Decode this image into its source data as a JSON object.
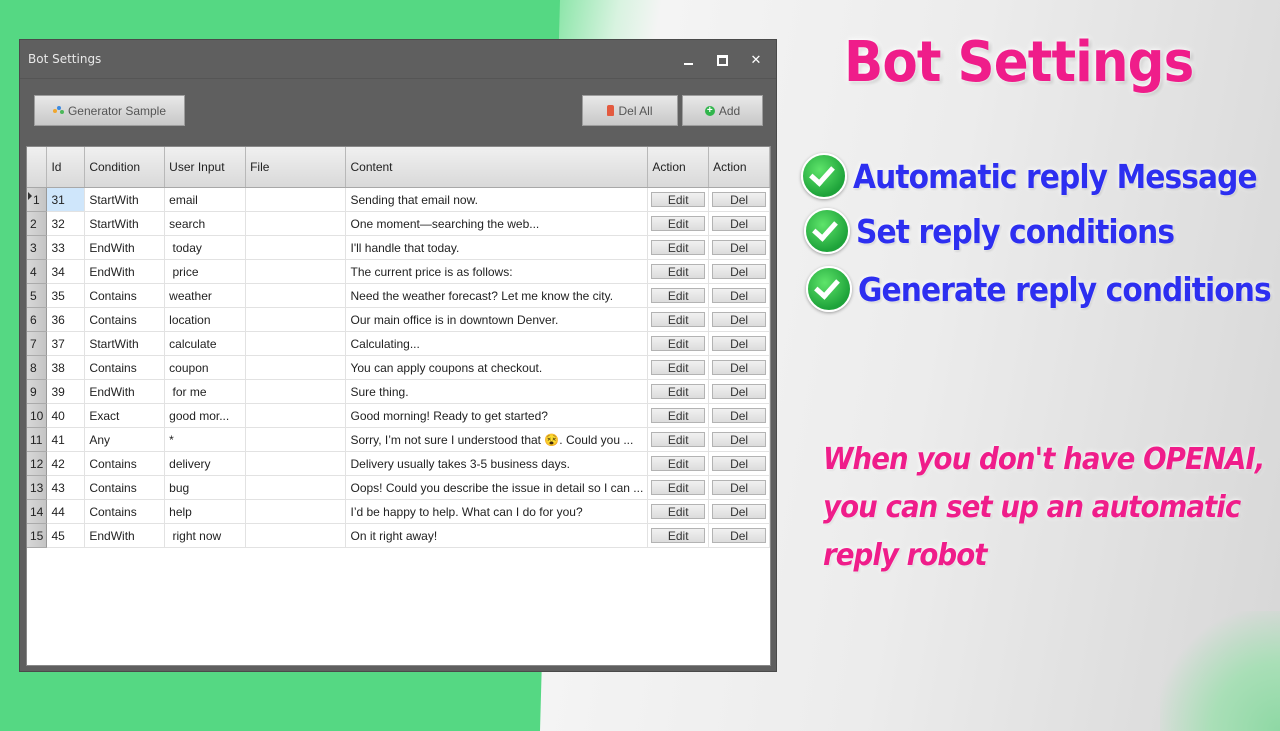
{
  "window": {
    "title": "Bot Settings",
    "toolbar": {
      "generator_label": "Generator Sample",
      "del_all_label": "Del All",
      "add_label": "Add"
    },
    "columns": [
      "Id",
      "Condition",
      "User Input",
      "File",
      "Content",
      "Action",
      "Action"
    ],
    "rows": [
      {
        "n": "1",
        "id": "31",
        "condition": "StartWith",
        "input": "email",
        "file": "",
        "content": "Sending that email now.",
        "edit": "Edit",
        "del": "Del"
      },
      {
        "n": "2",
        "id": "32",
        "condition": "StartWith",
        "input": "search",
        "file": "",
        "content": "One moment—searching the web...",
        "edit": "Edit",
        "del": "Del"
      },
      {
        "n": "3",
        "id": "33",
        "condition": "EndWith",
        "input": " today",
        "file": "",
        "content": "I'll handle that today.",
        "edit": "Edit",
        "del": "Del"
      },
      {
        "n": "4",
        "id": "34",
        "condition": "EndWith",
        "input": " price",
        "file": "",
        "content": "The current price is as follows:",
        "edit": "Edit",
        "del": "Del"
      },
      {
        "n": "5",
        "id": "35",
        "condition": "Contains",
        "input": "weather",
        "file": "",
        "content": "Need the weather forecast? Let me know the city.",
        "edit": "Edit",
        "del": "Del"
      },
      {
        "n": "6",
        "id": "36",
        "condition": "Contains",
        "input": "location",
        "file": "",
        "content": "Our main office is in downtown Denver.",
        "edit": "Edit",
        "del": "Del"
      },
      {
        "n": "7",
        "id": "37",
        "condition": "StartWith",
        "input": "calculate",
        "file": "",
        "content": "Calculating...",
        "edit": "Edit",
        "del": "Del"
      },
      {
        "n": "8",
        "id": "38",
        "condition": "Contains",
        "input": "coupon",
        "file": "",
        "content": "You can apply coupons at checkout.",
        "edit": "Edit",
        "del": "Del"
      },
      {
        "n": "9",
        "id": "39",
        "condition": "EndWith",
        "input": " for me",
        "file": "",
        "content": "Sure thing.",
        "edit": "Edit",
        "del": "Del"
      },
      {
        "n": "10",
        "id": "40",
        "condition": "Exact",
        "input": "good mor...",
        "file": "",
        "content": "Good morning! Ready to get started?",
        "edit": "Edit",
        "del": "Del"
      },
      {
        "n": "11",
        "id": "41",
        "condition": "Any",
        "input": "*",
        "file": "",
        "content": "Sorry, I’m not sure I understood that 😵. Could you ...",
        "edit": "Edit",
        "del": "Del"
      },
      {
        "n": "12",
        "id": "42",
        "condition": "Contains",
        "input": "delivery",
        "file": "",
        "content": "Delivery usually takes 3-5 business days.",
        "edit": "Edit",
        "del": "Del"
      },
      {
        "n": "13",
        "id": "43",
        "condition": "Contains",
        "input": "bug",
        "file": "",
        "content": "Oops! Could you describe the issue in detail so I can ...",
        "edit": "Edit",
        "del": "Del"
      },
      {
        "n": "14",
        "id": "44",
        "condition": "Contains",
        "input": "help",
        "file": "",
        "content": "I’d be happy to help. What can I do for you?",
        "edit": "Edit",
        "del": "Del"
      },
      {
        "n": "15",
        "id": "45",
        "condition": "EndWith",
        "input": " right now",
        "file": "",
        "content": "On it right away!",
        "edit": "Edit",
        "del": "Del"
      }
    ]
  },
  "promo": {
    "title": "Bot Settings",
    "features": [
      "Automatic reply Message",
      "Set reply conditions",
      "Generate reply conditions"
    ],
    "note_lines": [
      "When you don't have OPENAI,",
      "you can set up an automatic",
      "reply robot"
    ]
  },
  "colors": {
    "promo_pink": "#ef1d8a",
    "feature_blue": "#2d2ff0",
    "check_green": "#1ea33a",
    "window_gray": "#5f5f5f",
    "selected_cell": "#cfe6fb"
  },
  "icons": [
    "generator-icon",
    "trash-icon",
    "plus-circle-icon",
    "check-icon",
    "minimize-icon",
    "maximize-icon",
    "close-icon",
    "row-pointer-icon"
  ]
}
